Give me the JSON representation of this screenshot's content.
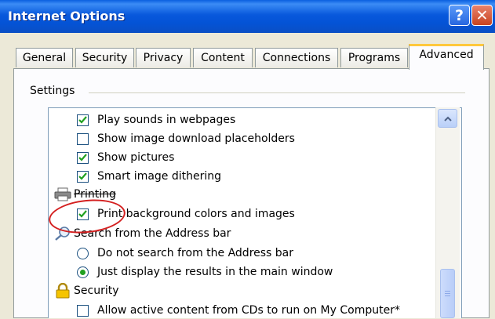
{
  "window": {
    "title": "Internet Options",
    "help_glyph": "?",
    "close_glyph": "✕"
  },
  "tabs": [
    {
      "label": "General",
      "active": false
    },
    {
      "label": "Security",
      "active": false
    },
    {
      "label": "Privacy",
      "active": false
    },
    {
      "label": "Content",
      "active": false
    },
    {
      "label": "Connections",
      "active": false
    },
    {
      "label": "Programs",
      "active": false
    },
    {
      "label": "Advanced",
      "active": true
    }
  ],
  "settings": {
    "group_label": "Settings",
    "items": [
      {
        "kind": "checkbox",
        "label": "Play sounds in webpages",
        "checked": true
      },
      {
        "kind": "checkbox",
        "label": "Show image download placeholders",
        "checked": false
      },
      {
        "kind": "checkbox",
        "label": "Show pictures",
        "checked": true
      },
      {
        "kind": "checkbox",
        "label": "Smart image dithering",
        "checked": true
      },
      {
        "kind": "category",
        "label": "Printing",
        "icon": "printer-icon"
      },
      {
        "kind": "checkbox",
        "label": "Print background colors and images",
        "checked": true
      },
      {
        "kind": "category",
        "label": "Search from the Address bar",
        "icon": "magnifier-icon"
      },
      {
        "kind": "radio",
        "label": "Do not search from the Address bar",
        "selected": false
      },
      {
        "kind": "radio",
        "label": "Just display the results in the main window",
        "selected": true
      },
      {
        "kind": "category",
        "label": "Security",
        "icon": "padlock-icon"
      },
      {
        "kind": "checkbox",
        "label": "Allow active content from CDs to run on My Computer*",
        "checked": false
      }
    ]
  },
  "colors": {
    "titlebar": "#0858dc",
    "check": "#21a121",
    "annotation": "#d42020",
    "active_tab_accent": "#ffc83c"
  }
}
